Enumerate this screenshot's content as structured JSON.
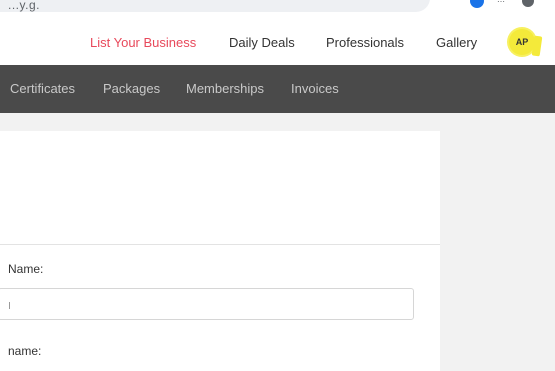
{
  "browser": {
    "address_fragment": "...y.g."
  },
  "top_nav": {
    "list_business": "List Your Business",
    "daily_deals": "Daily Deals",
    "professionals": "Professionals",
    "gallery": "Gallery",
    "avatar_initials": "AP",
    "accent_color": "#e8495b",
    "highlight_color": "#f4ea3a"
  },
  "sub_nav": {
    "items": [
      "Certificates",
      "Packages",
      "Memberships",
      "Invoices"
    ],
    "background": "#4a4a4a"
  },
  "form": {
    "first_name_label": "Name:",
    "first_name_value": "",
    "last_name_label": "name:"
  }
}
